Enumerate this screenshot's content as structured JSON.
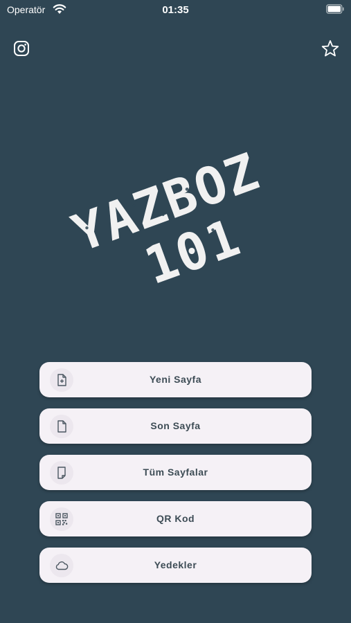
{
  "status_bar": {
    "carrier": "Operatör",
    "time": "01:35"
  },
  "header": {
    "left_icon": "instagram-icon",
    "right_icon": "star-icon"
  },
  "logo": {
    "line1": "YAZBOZ",
    "line2": "101"
  },
  "menu": {
    "items": [
      {
        "label": "Yeni Sayfa",
        "icon": "new-page-icon"
      },
      {
        "label": "Son Sayfa",
        "icon": "page-icon"
      },
      {
        "label": "Tüm Sayfalar",
        "icon": "pages-icon"
      },
      {
        "label": "QR Kod",
        "icon": "qr-code-icon"
      },
      {
        "label": "Yedekler",
        "icon": "cloud-icon"
      }
    ]
  },
  "colors": {
    "background": "#2f4654",
    "button_background": "#f5f1f6",
    "button_text": "#3d4c55"
  }
}
